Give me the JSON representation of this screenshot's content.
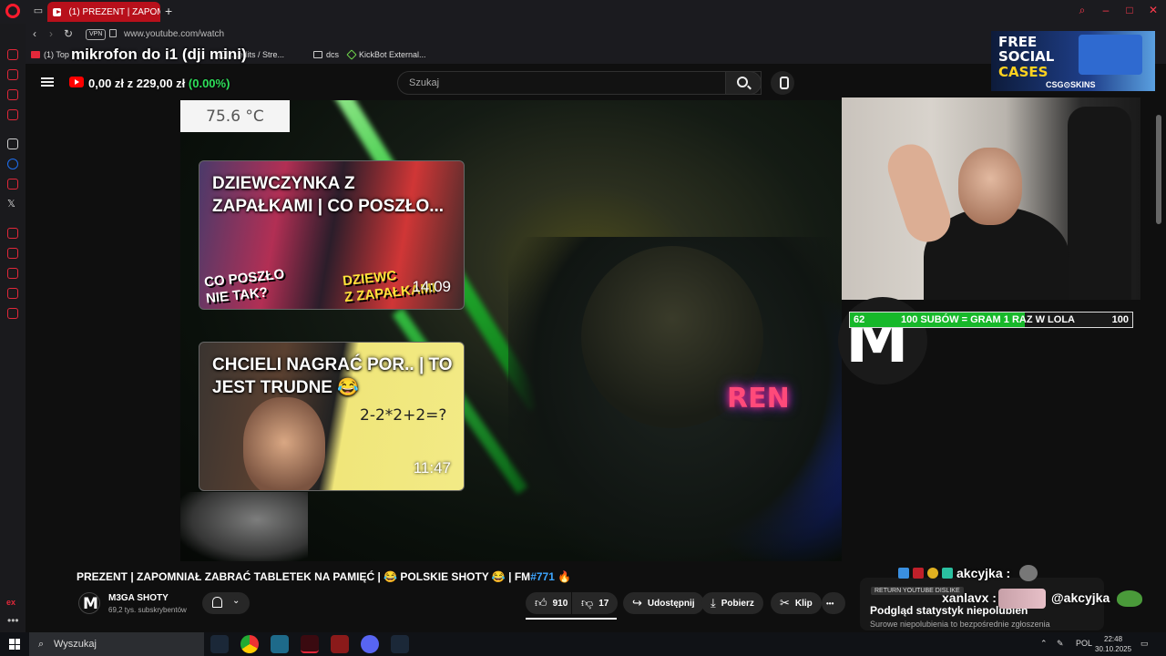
{
  "browser": {
    "tab_title": "(1) PREZENT | ZAPOMNIAŁ",
    "url": "www.youtube.com/watch",
    "vpn_label": "VPN",
    "bookmarks": [
      {
        "label": "(1) Top",
        "icon": "youtube-icon"
      },
      {
        "label": "...edits / Stre...",
        "icon": "grid-icon"
      },
      {
        "label": "dcs",
        "icon": "folder-icon"
      },
      {
        "label": "KickBot External...",
        "icon": "kickbot-icon"
      }
    ]
  },
  "overlay": {
    "mic_text": "mikrofon do i1 (dji mini)",
    "money_current": "0,00 zł",
    "money_separator": "z",
    "money_goal": "229,00 zł",
    "money_percent": "(0.00%)",
    "temperature": "75.6 °C",
    "sub_goal": {
      "left": "62",
      "text": "100 SUBÓW = GRAM 1 RAZ W LOLA",
      "right": "100",
      "progress": 0.62
    },
    "neon_sign": "REN",
    "ad": {
      "line1": "FREE",
      "line2": "SOCIAL",
      "line3": "CASES",
      "brand": "CSG⊙SKINS"
    }
  },
  "youtube": {
    "search_placeholder": "Szukaj",
    "cards": [
      {
        "title": "DZIEWCZYNKA Z ZAPAŁKAMI | CO POSZŁO...",
        "duration": "14:09",
        "overlay_left": "CO POSZŁO\nNIE TAK?",
        "overlay_right": "DZIEWC\nZ ZAPAŁKAMI"
      },
      {
        "title": "CHCIELI NAGRAĆ POR.. | TO JEST TRUDNE 😂",
        "duration": "11:47",
        "math": "2-2*2+2=?"
      }
    ],
    "video_title_main": "PREZENT | ZAPOMNIAŁ ZABRAĆ TABLETEK NA PAMIĘĆ | 😂 POLSKIE SHOTY 😂 | FM",
    "video_title_hash": "#771",
    "video_title_end": " 🔥",
    "channel_name": "M3GA SHOTY",
    "channel_subs": "69,2 tys. subskrybentów",
    "likes": "910",
    "dislikes": "17",
    "share_label": "Udostępnij",
    "download_label": "Pobierz",
    "clip_label": "Klip",
    "more_label": "•••"
  },
  "chat": {
    "user1": "akcyjka :",
    "user2": "xanlavx :",
    "msg2": "@akcyjka"
  },
  "ryd": {
    "badge": "RETURN YOUTUBE DISLIKE",
    "title": "Podgląd statystyk niepolubień",
    "subtitle": "Surowe niepolubienia to bezpośrednie zgłoszenia"
  },
  "taskbar": {
    "search_label": "Wyszukaj",
    "lang": "POL",
    "time": "22:48",
    "date": "30.10.2025"
  }
}
